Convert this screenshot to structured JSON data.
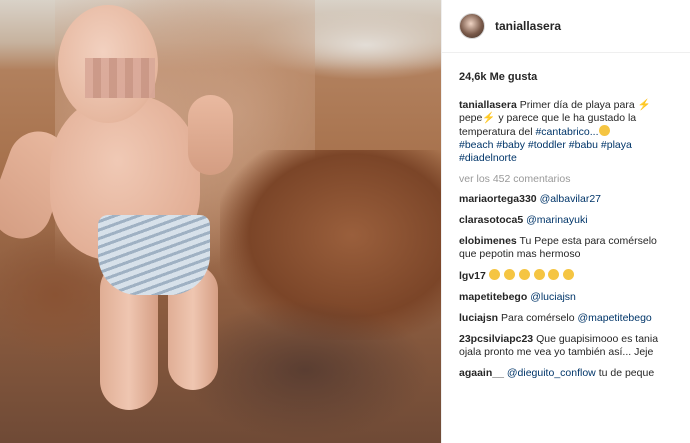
{
  "post": {
    "username": "taniallasera",
    "likes": "24,6k Me gusta",
    "caption": {
      "user": "taniallasera",
      "text1": "Primer día de playa para",
      "text2": "pepe",
      "text3": "y parece que le ha gustado la temperatura del",
      "tag_cantabrico": "#cantabrico...",
      "tags": [
        "#beach",
        "#baby",
        "#toddler",
        "#babu",
        "#playa",
        "#diadelnorte"
      ]
    },
    "view_all": "ver los 452 comentarios",
    "comments": [
      {
        "user": "mariaortega330",
        "mention": "@albavilar27",
        "text": ""
      },
      {
        "user": "clarasotoca5",
        "mention": "@marinayuki",
        "text": ""
      },
      {
        "user": "elobimenes",
        "mention": "",
        "text": "Tu Pepe esta para comérselo que pepotin mas hermoso"
      },
      {
        "user": "lgv17",
        "mention": "",
        "text": "",
        "emoji_count": 6
      },
      {
        "user": "mapetitebego",
        "mention": "@luciajsn",
        "text": ""
      },
      {
        "user": "luciajsn",
        "text_before": "Para comérselo",
        "mention": "@mapetitebego",
        "text": ""
      },
      {
        "user": "23pcsilviapc23",
        "mention": "",
        "text": "Que guapisimooo es tania ojala pronto me vea yo también así... Jeje"
      },
      {
        "user": "agaain__",
        "mention": "@dieguito_conflow",
        "text": "tu de peque"
      }
    ]
  },
  "colors": {
    "link": "#003569",
    "muted": "#999999",
    "text": "#262626"
  },
  "icons": {
    "avatar": "profile-avatar",
    "bolt": "lightning-emoji",
    "smile": "smiley-emoji"
  }
}
